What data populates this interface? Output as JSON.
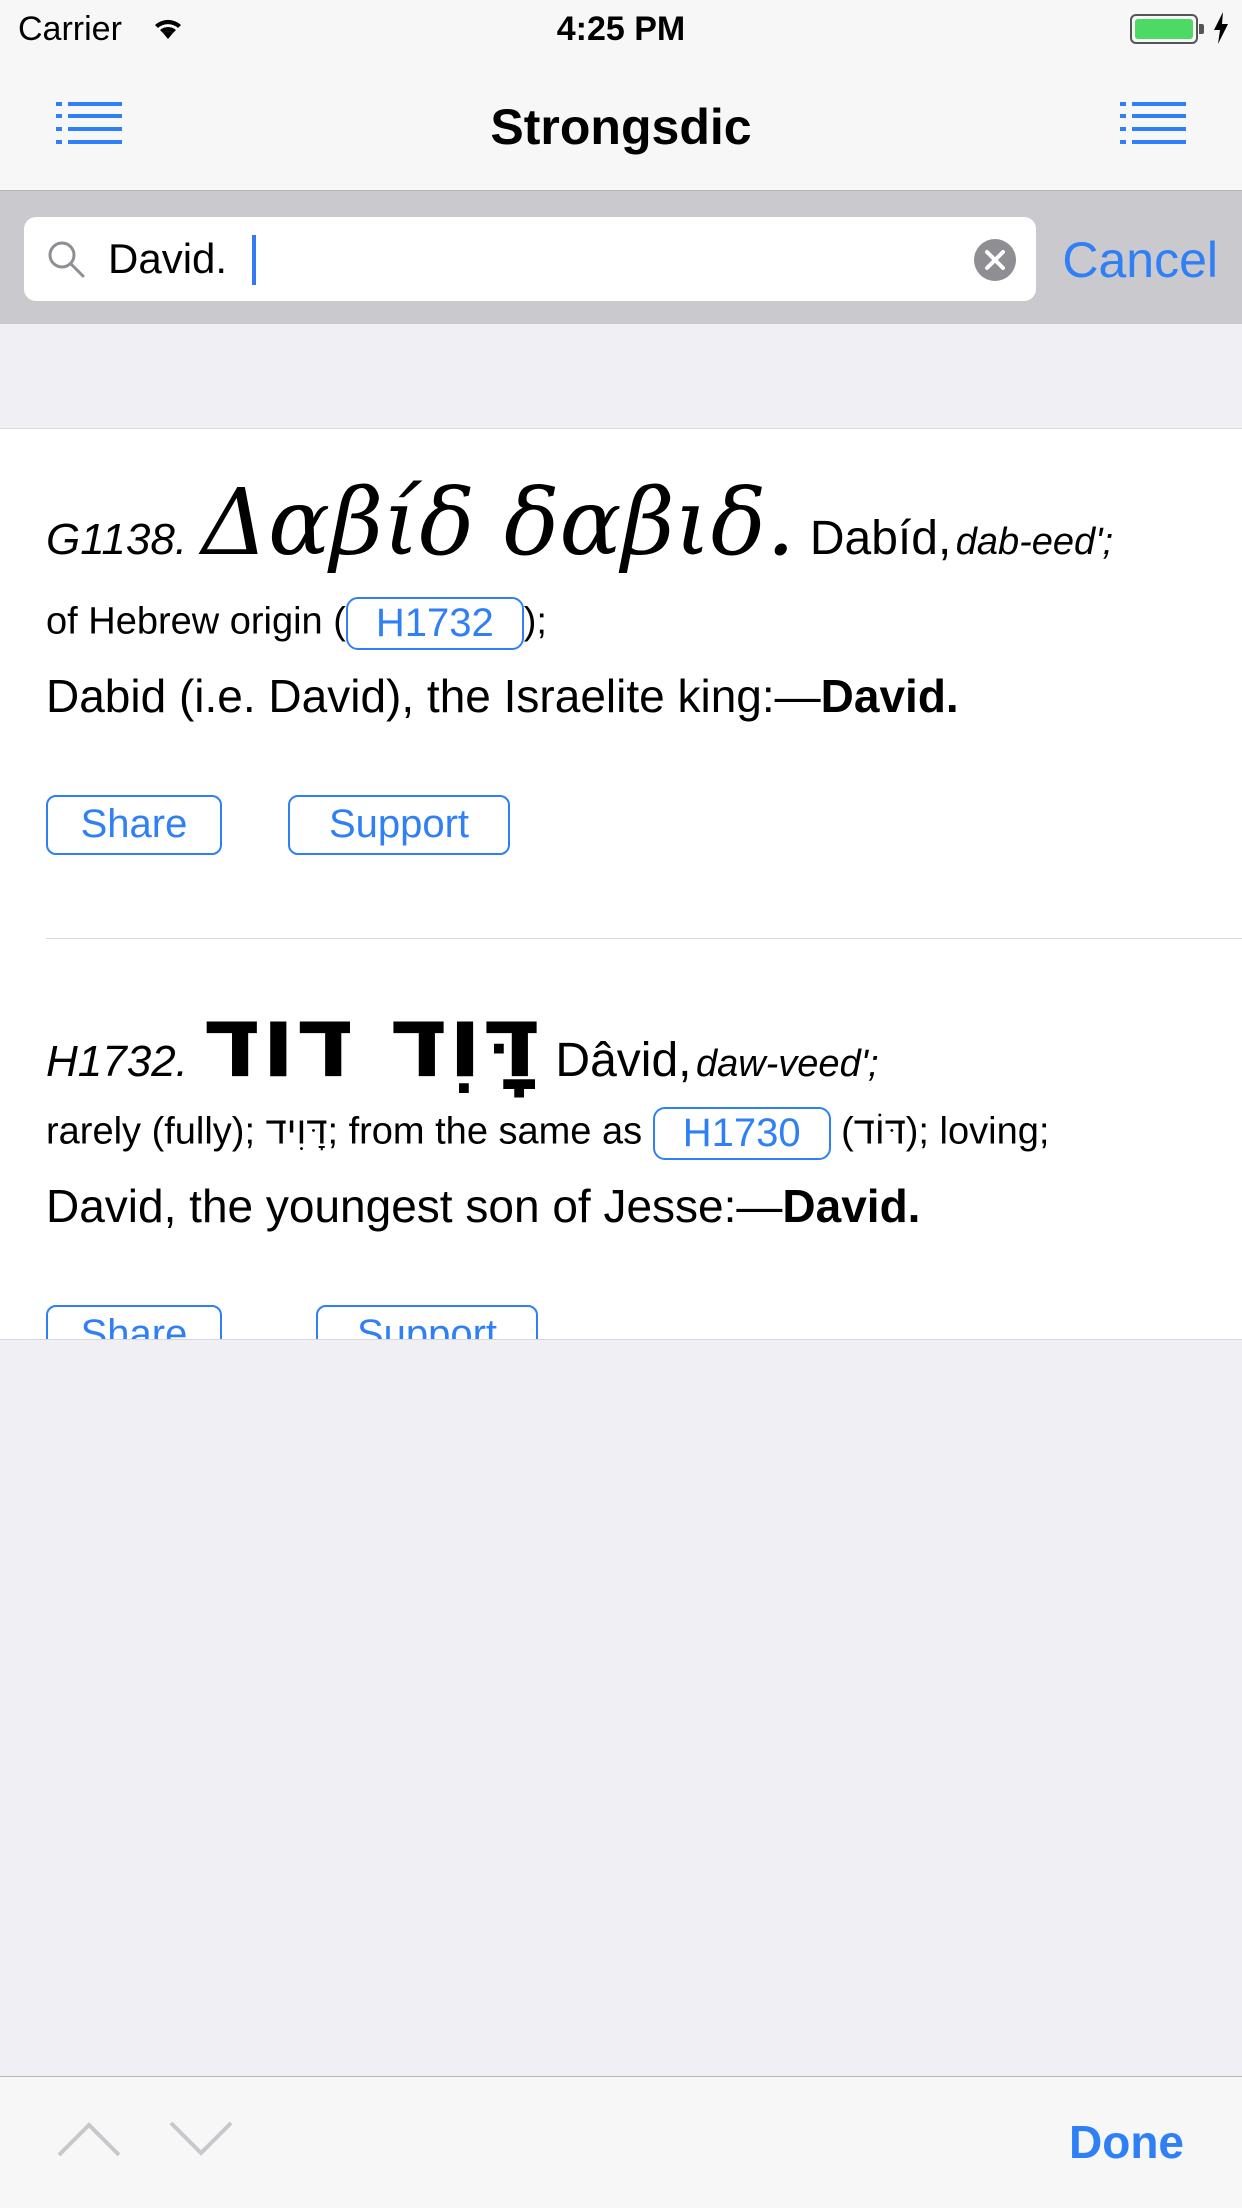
{
  "status_bar": {
    "carrier": "Carrier",
    "time": "4:25 PM"
  },
  "nav": {
    "title": "Strongsdic"
  },
  "search": {
    "value": "David.",
    "cancel_label": "Cancel"
  },
  "entries": [
    {
      "code": "G1138.",
      "lemma": "Δαβίδ  δαβιδ.",
      "transliteration": "Dabíd,",
      "pronunciation": "dab-eed';",
      "origin_prefix": "of Hebrew origin (",
      "ref": "H1732",
      "origin_suffix": ");",
      "definition": "Dabid (i.e. David), the Israelite king:—",
      "definition_bold": "David.",
      "share_label": "Share",
      "support_label": "Support"
    },
    {
      "code": "H1732.",
      "lemma": "דָּוִד  דוד",
      "transliteration": "Dâvid,",
      "pronunciation": "daw-veed';",
      "origin_prefix": "rarely (fully); דָּוִיד; from the same as ",
      "ref": "H1730",
      "origin_suffix": " (דּוֹד); loving;",
      "definition": "David, the youngest son of Jesse:—",
      "definition_bold": "David.",
      "share_label": "Share",
      "support_label": "Support"
    }
  ],
  "toolbar": {
    "done_label": "Done"
  },
  "colors": {
    "accent": "#2f7ff6",
    "background": "#efeff4",
    "battery": "#4cd964"
  }
}
